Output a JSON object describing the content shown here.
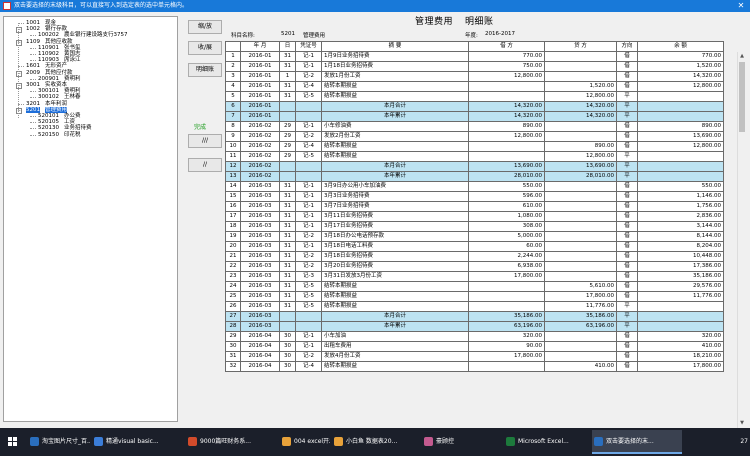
{
  "window": {
    "title": "双击要选择的末级科目，可以直接写入到选定表的选中单元格内。"
  },
  "tree": {
    "nodes": [
      {
        "code": "1001",
        "name": "现金",
        "level": 0,
        "expander": ""
      },
      {
        "code": "1002",
        "name": "银行存款",
        "level": 0,
        "expander": "−"
      },
      {
        "code": "100202",
        "name": "農业银行建设路支行3757",
        "level": 1,
        "expander": ""
      },
      {
        "code": "1109",
        "name": "其他应收款",
        "level": 0,
        "expander": "−"
      },
      {
        "code": "110901",
        "name": "张书玺",
        "level": 1,
        "expander": ""
      },
      {
        "code": "110902",
        "name": "黄国志",
        "level": 1,
        "expander": ""
      },
      {
        "code": "110903",
        "name": "席泳江",
        "level": 1,
        "expander": ""
      },
      {
        "code": "1601",
        "name": "无形资产",
        "level": 0,
        "expander": ""
      },
      {
        "code": "2009",
        "name": "其他应付款",
        "level": 0,
        "expander": "−"
      },
      {
        "code": "200901",
        "name": "费明利",
        "level": 1,
        "expander": ""
      },
      {
        "code": "3001",
        "name": "实收资本",
        "level": 0,
        "expander": "−"
      },
      {
        "code": "300101",
        "name": "费明利",
        "level": 1,
        "expander": ""
      },
      {
        "code": "300102",
        "name": "王林春",
        "level": 1,
        "expander": ""
      },
      {
        "code": "3201",
        "name": "本年利润",
        "level": 0,
        "expander": ""
      },
      {
        "code": "5201",
        "name": "管理费用",
        "level": 0,
        "expander": "−",
        "selected": true
      },
      {
        "code": "520101",
        "name": "办公费",
        "level": 1,
        "expander": ""
      },
      {
        "code": "520105",
        "name": "工资",
        "level": 1,
        "expander": ""
      },
      {
        "code": "520130",
        "name": "业务招待费",
        "level": 1,
        "expander": ""
      },
      {
        "code": "520150",
        "name": "印花税",
        "level": 1,
        "expander": ""
      }
    ]
  },
  "buttons": {
    "shrink": "缩/放",
    "collapse": "收/展",
    "detail": "明细账",
    "slash3": "///",
    "slash2": "//"
  },
  "green_label": "完成",
  "report": {
    "title": "管理费用",
    "subtitle": "明细账",
    "subject_label": "科目名称:",
    "subject_code": "5201",
    "subject_name": "管理费用",
    "year_label": "年度:",
    "year_value": "2016-2017",
    "columns": [
      "",
      "年 月",
      "日",
      "凭证号",
      "摘 要",
      "借 方",
      "贷 方",
      "方向",
      "余 额"
    ]
  },
  "ledger_rows": [
    {
      "n": "1",
      "ym": "2016-01",
      "d": "31",
      "v": "记-1",
      "desc": "1月9日业务招待费",
      "dr": "770.00",
      "cr": "",
      "dir": "借",
      "bal": "770.00"
    },
    {
      "n": "2",
      "ym": "2016-01",
      "d": "31",
      "v": "记-1",
      "desc": "1月18日业务招待费",
      "dr": "750.00",
      "cr": "",
      "dir": "借",
      "bal": "1,520.00"
    },
    {
      "n": "3",
      "ym": "2016-01",
      "d": "1",
      "v": "记-2",
      "desc": "发放1月份工资",
      "dr": "12,800.00",
      "cr": "",
      "dir": "借",
      "bal": "14,320.00"
    },
    {
      "n": "4",
      "ym": "2016-01",
      "d": "31",
      "v": "记-4",
      "desc": "结转本期损益",
      "dr": "",
      "cr": "1,520.00",
      "dir": "借",
      "bal": "12,800.00"
    },
    {
      "n": "5",
      "ym": "2016-01",
      "d": "31",
      "v": "记-5",
      "desc": "结转本期损益",
      "dr": "",
      "cr": "12,800.00",
      "dir": "平",
      "bal": ""
    },
    {
      "n": "6",
      "ym": "2016-01",
      "d": "",
      "v": "",
      "desc": "本月合计",
      "dr": "14,320.00",
      "cr": "14,320.00",
      "dir": "平",
      "bal": "",
      "sub": true
    },
    {
      "n": "7",
      "ym": "2016-01",
      "d": "",
      "v": "",
      "desc": "本年累计",
      "dr": "14,320.00",
      "cr": "14,320.00",
      "dir": "平",
      "bal": "",
      "sub": true
    },
    {
      "n": "8",
      "ym": "2016-02",
      "d": "29",
      "v": "记-1",
      "desc": "小车修油费",
      "dr": "890.00",
      "cr": "",
      "dir": "借",
      "bal": "890.00"
    },
    {
      "n": "9",
      "ym": "2016-02",
      "d": "29",
      "v": "记-2",
      "desc": "发放2月份工资",
      "dr": "12,800.00",
      "cr": "",
      "dir": "借",
      "bal": "13,690.00"
    },
    {
      "n": "10",
      "ym": "2016-02",
      "d": "29",
      "v": "记-4",
      "desc": "结转本期损益",
      "dr": "",
      "cr": "890.00",
      "dir": "借",
      "bal": "12,800.00"
    },
    {
      "n": "11",
      "ym": "2016-02",
      "d": "29",
      "v": "记-5",
      "desc": "结转本期损益",
      "dr": "",
      "cr": "12,800.00",
      "dir": "平",
      "bal": ""
    },
    {
      "n": "12",
      "ym": "2016-02",
      "d": "",
      "v": "",
      "desc": "本月合计",
      "dr": "13,690.00",
      "cr": "13,690.00",
      "dir": "平",
      "bal": "",
      "sub": true
    },
    {
      "n": "13",
      "ym": "2016-02",
      "d": "",
      "v": "",
      "desc": "本年累计",
      "dr": "28,010.00",
      "cr": "28,010.00",
      "dir": "平",
      "bal": "",
      "sub": true
    },
    {
      "n": "14",
      "ym": "2016-03",
      "d": "31",
      "v": "记-1",
      "desc": "3月9日办公用小车加油费",
      "dr": "550.00",
      "cr": "",
      "dir": "借",
      "bal": "550.00"
    },
    {
      "n": "15",
      "ym": "2016-03",
      "d": "31",
      "v": "记-1",
      "desc": "3月3日业务招待费",
      "dr": "596.00",
      "cr": "",
      "dir": "借",
      "bal": "1,146.00"
    },
    {
      "n": "16",
      "ym": "2016-03",
      "d": "31",
      "v": "记-1",
      "desc": "3月7日业务招待费",
      "dr": "610.00",
      "cr": "",
      "dir": "借",
      "bal": "1,756.00"
    },
    {
      "n": "17",
      "ym": "2016-03",
      "d": "31",
      "v": "记-1",
      "desc": "3月11日业务招待费",
      "dr": "1,080.00",
      "cr": "",
      "dir": "借",
      "bal": "2,836.00"
    },
    {
      "n": "18",
      "ym": "2016-03",
      "d": "31",
      "v": "记-1",
      "desc": "3月17日业务招待费",
      "dr": "308.00",
      "cr": "",
      "dir": "借",
      "bal": "3,144.00"
    },
    {
      "n": "19",
      "ym": "2016-03",
      "d": "31",
      "v": "记-2",
      "desc": "3月18日办公电话预存款",
      "dr": "5,000.00",
      "cr": "",
      "dir": "借",
      "bal": "8,144.00"
    },
    {
      "n": "20",
      "ym": "2016-03",
      "d": "31",
      "v": "记-1",
      "desc": "3月18日电话工料费",
      "dr": "60.00",
      "cr": "",
      "dir": "借",
      "bal": "8,204.00"
    },
    {
      "n": "21",
      "ym": "2016-03",
      "d": "31",
      "v": "记-2",
      "desc": "3月18日业务招待费",
      "dr": "2,244.00",
      "cr": "",
      "dir": "借",
      "bal": "10,448.00"
    },
    {
      "n": "22",
      "ym": "2016-03",
      "d": "31",
      "v": "记-2",
      "desc": "3月20日业务招待费",
      "dr": "6,938.00",
      "cr": "",
      "dir": "借",
      "bal": "17,386.00"
    },
    {
      "n": "23",
      "ym": "2016-03",
      "d": "31",
      "v": "记-3",
      "desc": "3月31日发放3月份工资",
      "dr": "17,800.00",
      "cr": "",
      "dir": "借",
      "bal": "35,186.00"
    },
    {
      "n": "24",
      "ym": "2016-03",
      "d": "31",
      "v": "记-5",
      "desc": "结转本期损益",
      "dr": "",
      "cr": "5,610.00",
      "dir": "借",
      "bal": "29,576.00"
    },
    {
      "n": "25",
      "ym": "2016-03",
      "d": "31",
      "v": "记-5",
      "desc": "结转本期损益",
      "dr": "",
      "cr": "17,800.00",
      "dir": "借",
      "bal": "11,776.00"
    },
    {
      "n": "26",
      "ym": "2016-03",
      "d": "31",
      "v": "记-5",
      "desc": "结转本期损益",
      "dr": "",
      "cr": "11,776.00",
      "dir": "平",
      "bal": ""
    },
    {
      "n": "27",
      "ym": "2016-03",
      "d": "",
      "v": "",
      "desc": "本月合计",
      "dr": "35,186.00",
      "cr": "35,186.00",
      "dir": "平",
      "bal": "",
      "sub": true
    },
    {
      "n": "28",
      "ym": "2016-03",
      "d": "",
      "v": "",
      "desc": "本年累计",
      "dr": "63,196.00",
      "cr": "63,196.00",
      "dir": "平",
      "bal": "",
      "sub": true
    },
    {
      "n": "29",
      "ym": "2016-04",
      "d": "30",
      "v": "记-1",
      "desc": "小车加油",
      "dr": "320.00",
      "cr": "",
      "dir": "借",
      "bal": "320.00"
    },
    {
      "n": "30",
      "ym": "2016-04",
      "d": "30",
      "v": "记-1",
      "desc": "出租车费用",
      "dr": "90.00",
      "cr": "",
      "dir": "借",
      "bal": "410.00"
    },
    {
      "n": "31",
      "ym": "2016-04",
      "d": "30",
      "v": "记-2",
      "desc": "发放4月份工资",
      "dr": "17,800.00",
      "cr": "",
      "dir": "借",
      "bal": "18,210.00"
    },
    {
      "n": "32",
      "ym": "2016-04",
      "d": "30",
      "v": "记-4",
      "desc": "结转本期损益",
      "dr": "",
      "cr": "410.00",
      "dir": "借",
      "bal": "17,800.00"
    }
  ],
  "taskbar": {
    "items": [
      {
        "label": "淘宝图片尺寸_百...",
        "color": "#2a6ebd"
      },
      {
        "label": "精通visual basic...",
        "color": "#3b7dd8"
      },
      {
        "label": "9000篇旺财务系...",
        "color": "#d24b2b"
      },
      {
        "label": "004 excel开发...",
        "color": "#e8a23a"
      },
      {
        "label": "小白鱼 数据表20...",
        "color": "#e8a23a"
      },
      {
        "label": "豪顾控",
        "color": "#c35a8f"
      },
      {
        "label": "Microsoft Excel...",
        "color": "#1d7a3c"
      },
      {
        "label": "双击要选择的末...",
        "color": "#2a6ebd"
      }
    ],
    "clock": "27"
  }
}
